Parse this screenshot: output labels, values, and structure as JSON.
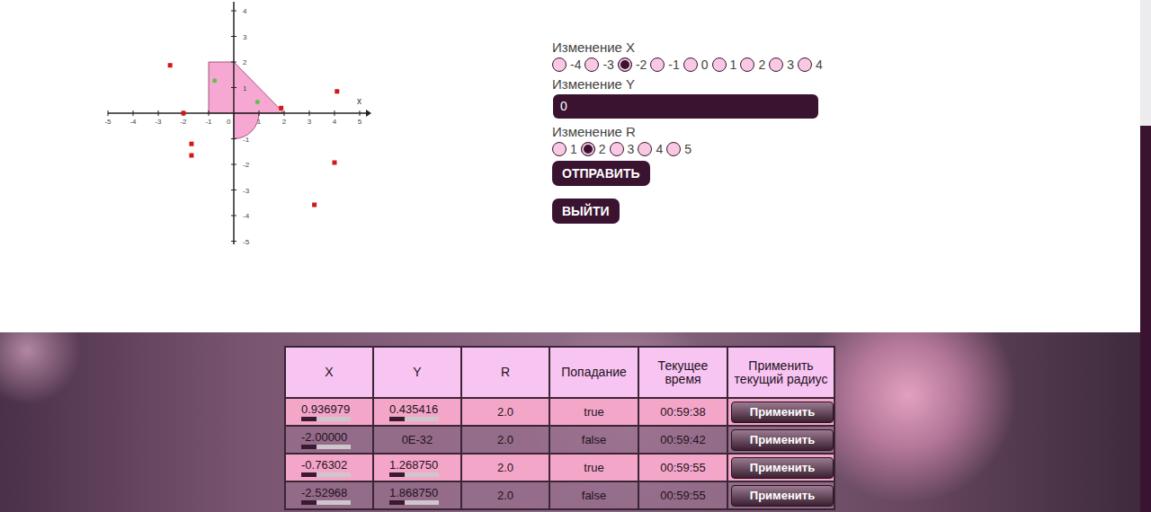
{
  "chart": {
    "x_ticks": [
      "-5",
      "-4",
      "-3",
      "-2",
      "-1",
      "1",
      "2",
      "3",
      "4",
      "5"
    ],
    "y_ticks": [
      "4",
      "3",
      "2",
      "1",
      "-1",
      "-2",
      "-3",
      "-4",
      "-5"
    ],
    "origin_label": "0",
    "x_axis_label": "x",
    "radius": 2,
    "points": [
      {
        "x": -2.53,
        "y": 1.87,
        "hit": false
      },
      {
        "x": -2.0,
        "y": 0.0,
        "hit": false
      },
      {
        "x": -0.76,
        "y": 1.27,
        "hit": true
      },
      {
        "x": 0.94,
        "y": 0.44,
        "hit": true
      },
      {
        "x": 1.88,
        "y": 0.2,
        "hit": false
      },
      {
        "x": 4.1,
        "y": 0.85,
        "hit": false
      },
      {
        "x": -1.68,
        "y": -1.2,
        "hit": false
      },
      {
        "x": -1.68,
        "y": -1.65,
        "hit": false
      },
      {
        "x": 4.0,
        "y": -1.93,
        "hit": false
      },
      {
        "x": 3.2,
        "y": -3.58,
        "hit": false
      }
    ]
  },
  "form": {
    "x_label": "Изменение X",
    "x_options": [
      {
        "label": "-4",
        "selected": false
      },
      {
        "label": "-3",
        "selected": false
      },
      {
        "label": "-2",
        "selected": true
      },
      {
        "label": "-1",
        "selected": false
      },
      {
        "label": "0",
        "selected": false
      },
      {
        "label": "1",
        "selected": false
      },
      {
        "label": "2",
        "selected": false
      },
      {
        "label": "3",
        "selected": false
      },
      {
        "label": "4",
        "selected": false
      }
    ],
    "y_label": "Изменение Y",
    "y_value": "0",
    "r_label": "Изменение R",
    "r_options": [
      {
        "label": "1",
        "selected": false
      },
      {
        "label": "2",
        "selected": true
      },
      {
        "label": "3",
        "selected": false
      },
      {
        "label": "4",
        "selected": false
      },
      {
        "label": "5",
        "selected": false
      }
    ],
    "submit": "ОТПРАВИТЬ",
    "logout": "ВЫЙТИ"
  },
  "table": {
    "columns": [
      "X",
      "Y",
      "R",
      "Попадание",
      "Текущее время",
      "Применить текущий радиус"
    ],
    "rows": [
      {
        "cells": [
          {
            "text": "0.936979",
            "kind": "scroll",
            "level": 0.3
          },
          {
            "text": "0.435416",
            "kind": "scroll",
            "level": 0.3
          },
          {
            "text": "2.0",
            "kind": "plain"
          },
          {
            "text": "true",
            "kind": "plain"
          },
          {
            "text": "00:59:38",
            "kind": "plain"
          }
        ],
        "button": "Применить"
      },
      {
        "cells": [
          {
            "text": "-2.00000",
            "kind": "scroll",
            "level": 0.3
          },
          {
            "text": "0E-32",
            "kind": "plain"
          },
          {
            "text": "2.0",
            "kind": "plain"
          },
          {
            "text": "false",
            "kind": "plain"
          },
          {
            "text": "00:59:42",
            "kind": "plain"
          }
        ],
        "button": "Применить"
      },
      {
        "cells": [
          {
            "text": "-0.76302",
            "kind": "scroll",
            "level": 0.3
          },
          {
            "text": "1.268750",
            "kind": "scroll",
            "level": 0.3
          },
          {
            "text": "2.0",
            "kind": "plain"
          },
          {
            "text": "true",
            "kind": "plain"
          },
          {
            "text": "00:59:55",
            "kind": "plain"
          }
        ],
        "button": "Применить"
      },
      {
        "cells": [
          {
            "text": "-2.52968",
            "kind": "scroll",
            "level": 0.3
          },
          {
            "text": "1.868750",
            "kind": "scroll",
            "level": 0.3
          },
          {
            "text": "2.0",
            "kind": "plain"
          },
          {
            "text": "false",
            "kind": "plain"
          },
          {
            "text": "00:59:55",
            "kind": "plain"
          }
        ],
        "button": "Применить"
      }
    ]
  }
}
